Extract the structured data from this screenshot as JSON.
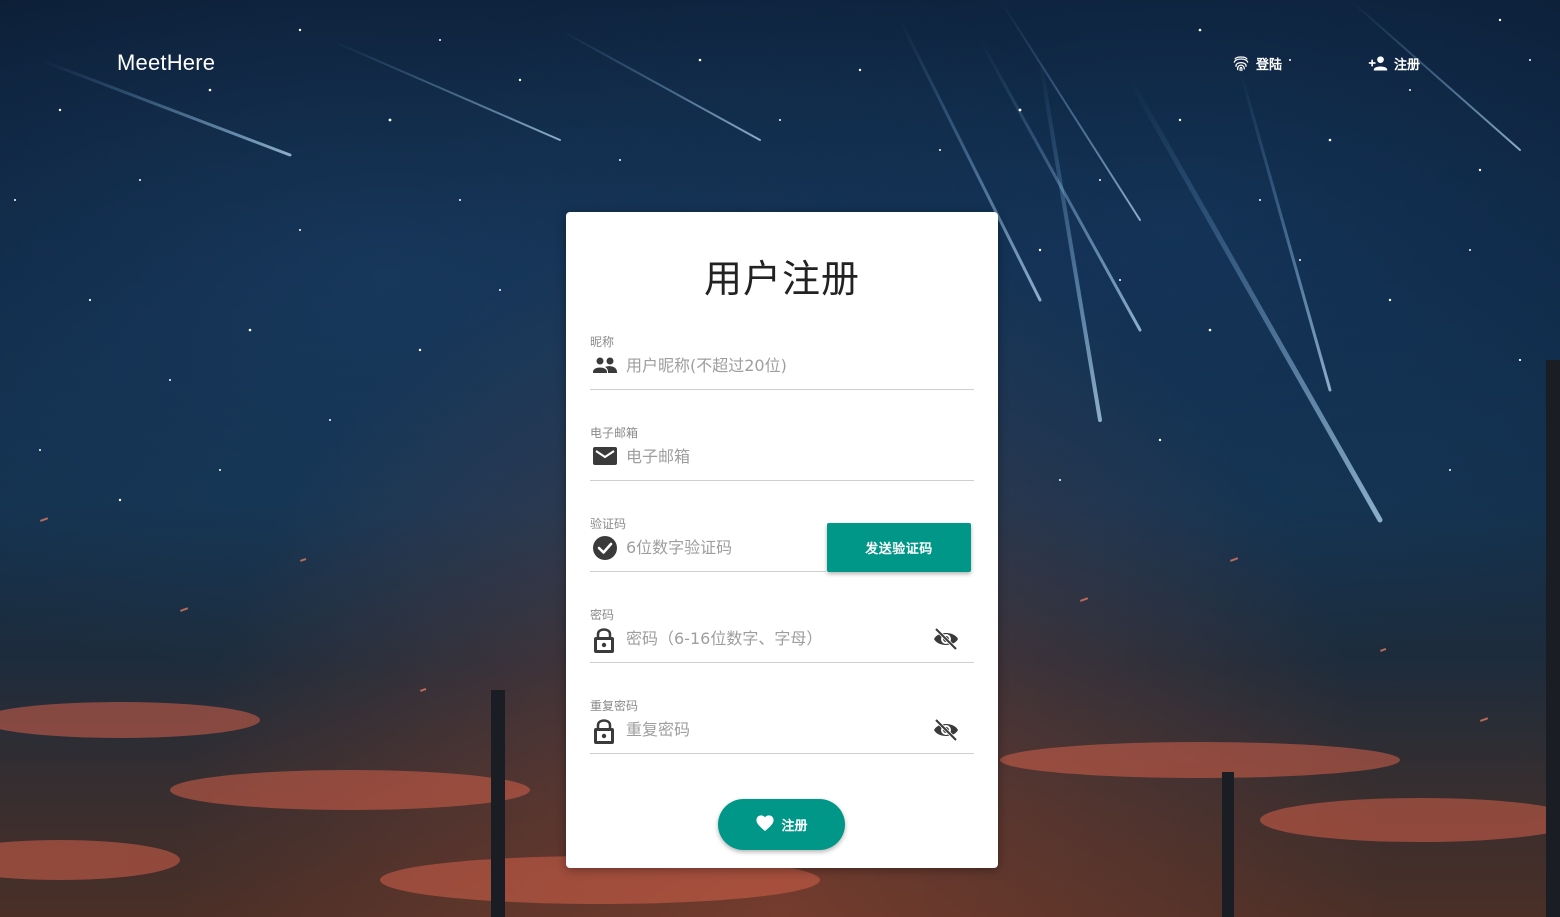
{
  "nav": {
    "brand": "MeetHere",
    "login_label": "登陆",
    "register_label": "注册",
    "login_icon": "fingerprint-icon",
    "register_icon": "person-add-icon"
  },
  "form": {
    "title": "用户注册",
    "fields": [
      {
        "label": "昵称",
        "placeholder": "用户昵称(不超过20位)",
        "value": "",
        "icon": "people-icon"
      },
      {
        "label": "电子邮箱",
        "placeholder": "电子邮箱",
        "value": "",
        "icon": "mail-icon"
      },
      {
        "label": "验证码",
        "placeholder": "6位数字验证码",
        "value": "",
        "icon": "check-circle-icon"
      },
      {
        "label": "密码",
        "placeholder": "密码（6-16位数字、字母）",
        "value": "",
        "icon": "lock-icon",
        "toggle_icon": "visibility-off-icon"
      },
      {
        "label": "重复密码",
        "placeholder": "重复密码",
        "value": "",
        "icon": "lock-icon",
        "toggle_icon": "visibility-off-icon"
      }
    ],
    "send_code_label": "发送验证码",
    "submit_label": "注册",
    "submit_icon": "heart-icon"
  },
  "colors": {
    "accent": "#009688",
    "card_bg": "#ffffff",
    "icon": "#3a3a3a"
  }
}
